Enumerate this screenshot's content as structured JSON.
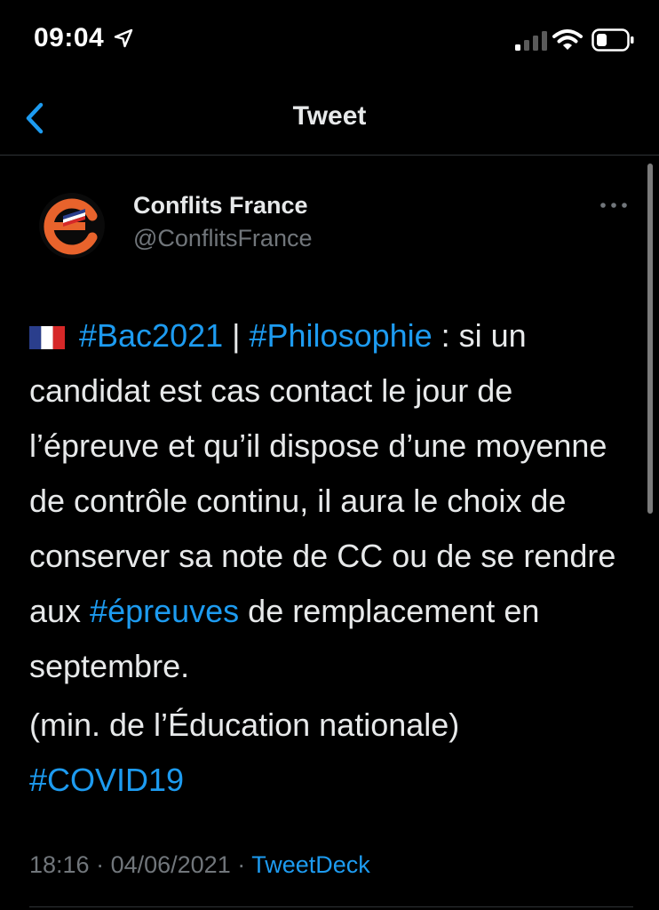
{
  "status_bar": {
    "time": "09:04",
    "location_icon": "location-arrow-icon",
    "signal_icon": "cellular-signal-icon",
    "wifi_icon": "wifi-icon",
    "battery_icon": "battery-icon"
  },
  "nav": {
    "title": "Tweet",
    "back_icon": "chevron-left-icon"
  },
  "tweet": {
    "author": {
      "display_name": "Conflits France",
      "handle": "@ConflitsFrance",
      "avatar_icon": "conflits-france-logo-icon"
    },
    "more_icon": "more-horizontal-icon",
    "flag_icon": "france-flag-icon",
    "hashtag_bac": "#Bac2021",
    "separator": " | ",
    "hashtag_philo": "#Philosophie",
    "text_part1": " : si un candidat est cas contact le jour de l’épreuve et qu’il dispose d’une moyenne de contrôle continu, il aura le choix de conserver sa note de CC ou de se rendre aux ",
    "hashtag_epreuves": "#épreuves",
    "text_part2": " de remplacement en septembre.",
    "source_line": "(min. de l’Éducation nationale)",
    "hashtag_covid": "#COVID19",
    "time": "18:16",
    "dot": " · ",
    "date": "04/06/2021",
    "source_app": "TweetDeck"
  },
  "colors": {
    "background": "#000000",
    "text": "#e7e9ea",
    "secondary_text": "#71767b",
    "accent": "#1d9bf0",
    "divider": "#2f3336"
  }
}
